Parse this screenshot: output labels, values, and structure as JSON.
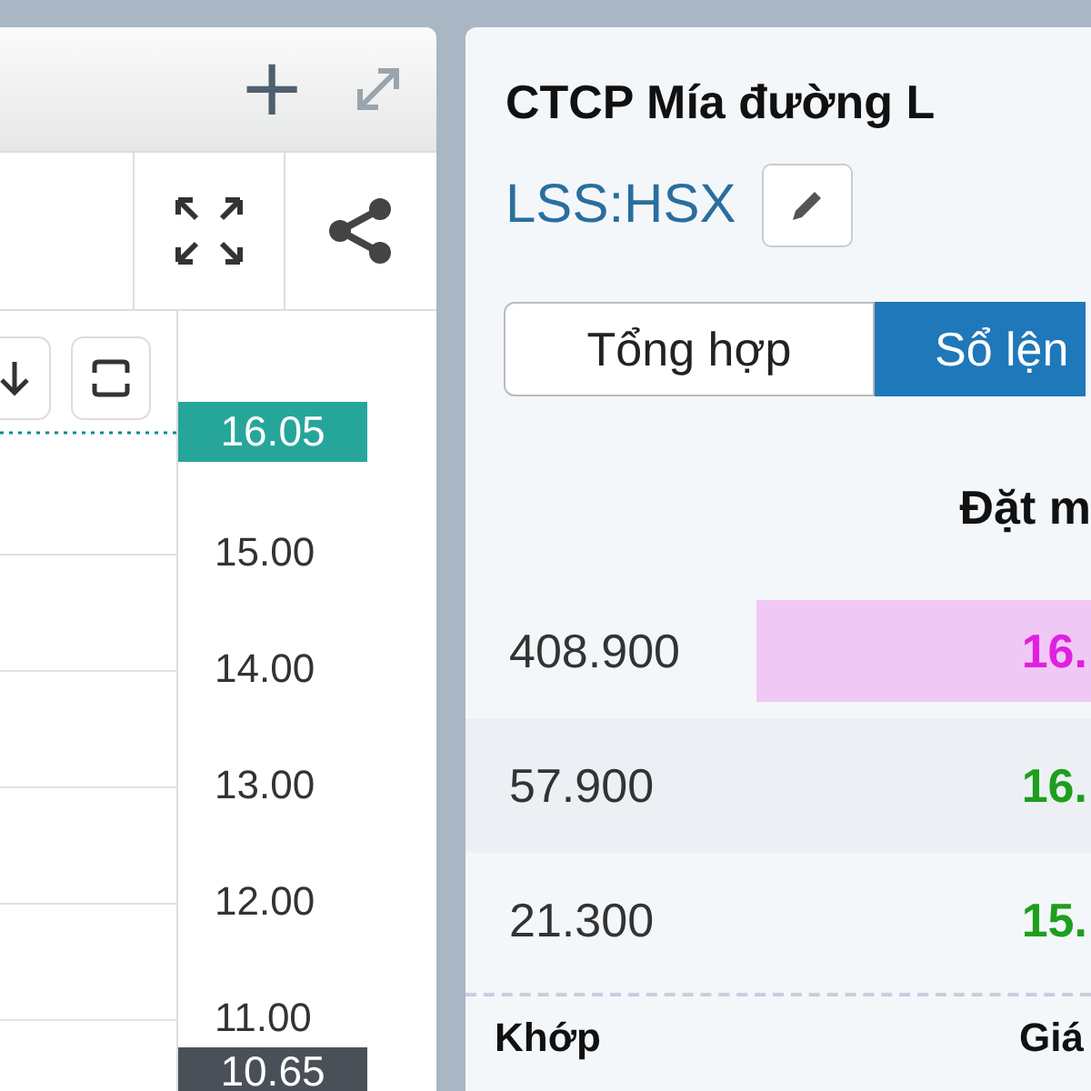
{
  "chart_panel": {
    "toolbar": {
      "add_label": "+"
    },
    "price_axis": {
      "labels": [
        "15.00",
        "14.00",
        "13.00",
        "12.00",
        "11.00"
      ],
      "last_price": "16.05",
      "cursor_price": "10.65"
    }
  },
  "stock_panel": {
    "title": "CTCP Mía đường L",
    "ticker": "LSS:HSX",
    "tabs": [
      {
        "label": "Tổng hợp",
        "selected": false
      },
      {
        "label": "Sổ lện",
        "selected": true
      }
    ],
    "order_book": {
      "heading": "Đặt m",
      "rows": [
        {
          "volume": "408.900",
          "price": "16.",
          "color": "#e020e0",
          "highlight": true
        },
        {
          "volume": "57.900",
          "price": "16.",
          "color": "#1e9e1e",
          "highlight": false
        },
        {
          "volume": "21.300",
          "price": "15.",
          "color": "#1e9e1e",
          "highlight": false
        }
      ]
    },
    "footer": {
      "column_1": "Khớp",
      "column_2": "Giá"
    }
  }
}
